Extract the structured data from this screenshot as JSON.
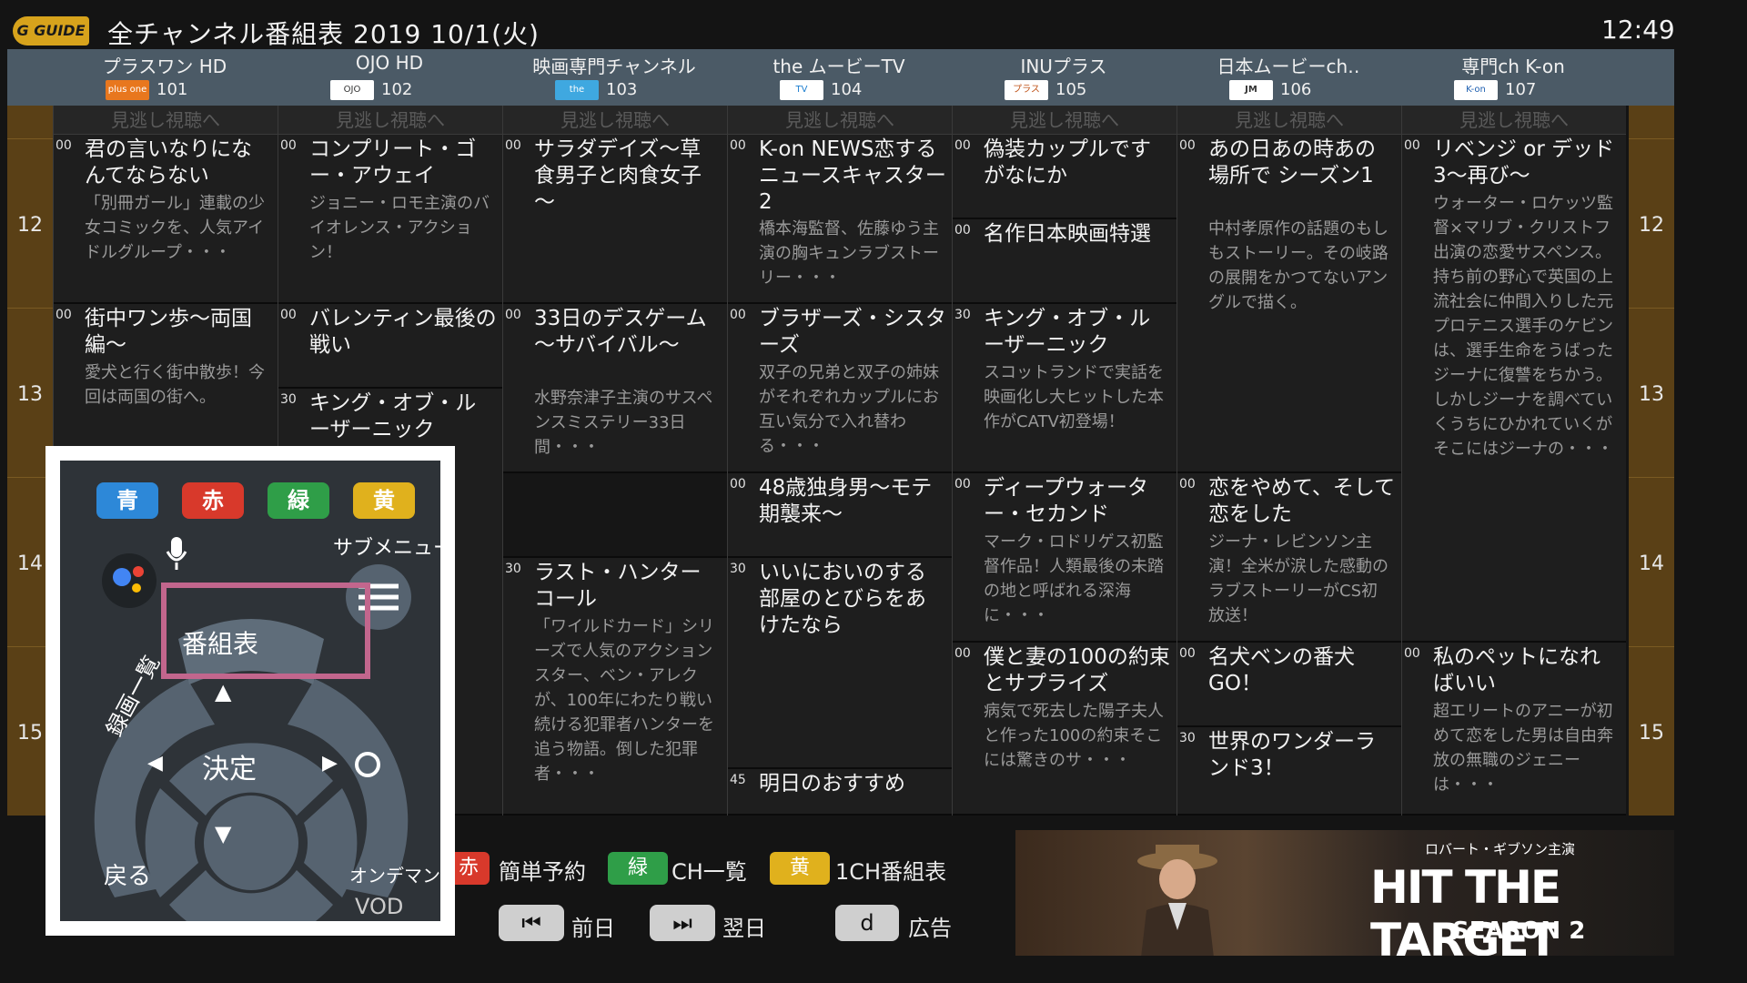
{
  "header": {
    "logo_text": "G GUIDE",
    "title": "全チャンネル番組表 2019 10/1(火)",
    "clock": "12:49"
  },
  "channels": [
    {
      "name": "プラスワン HD",
      "logo": "plus one",
      "number": "101"
    },
    {
      "name": "OJO HD",
      "logo": "OJO",
      "number": "102"
    },
    {
      "name": "映画専門チャンネル",
      "logo": "the MOVIE",
      "number": "103"
    },
    {
      "name": "the ムービーTV",
      "logo": "TV",
      "number": "104"
    },
    {
      "name": "INUプラス",
      "logo": "プラス",
      "number": "105"
    },
    {
      "name": "日本ムービーch‥",
      "logo": "JM",
      "number": "106"
    },
    {
      "name": "専門ch K-on",
      "logo": "K-on",
      "number": "107"
    }
  ],
  "hours": [
    "12",
    "13",
    "14",
    "15"
  ],
  "missed_label": "見逃し視聴へ",
  "programs": [
    [
      {
        "min": "00",
        "title": "君の言いなりになんてならない",
        "desc": "「別冊ガール」連載の少女コミックを、人気アイドルグループ・・・"
      },
      {
        "min": "00",
        "title": "街中ワン歩～両国編～",
        "desc": "愛犬と行く街中散歩！今回は両国の街へ。"
      }
    ],
    [
      {
        "min": "00",
        "title": "コンプリート・ゴー・アウェイ",
        "desc": "ジョニー・ロモ主演のバイオレンス・アクション！"
      },
      {
        "min": "00",
        "title": "バレンティン最後の戦い",
        "desc": ""
      },
      {
        "min": "30",
        "title": "キング・オブ・ルーザーニック",
        "desc": ""
      }
    ],
    [
      {
        "min": "00",
        "title": "サラダデイズ～草食男子と肉食女子～",
        "desc": ""
      },
      {
        "min": "00",
        "title": "33日のデスゲーム～サバイバル～",
        "desc": "水野奈津子主演のサスペンスミステリー33日間・・・"
      },
      {
        "min": "30",
        "title": "ラスト・ハンターコール",
        "desc": "「ワイルドカード」シリーズで人気のアクションスター、ベン・アレクが、100年にわたり戦い続ける犯罪者ハンターを追う物語。倒した犯罪者・・・"
      }
    ],
    [
      {
        "min": "00",
        "title": "K-on NEWS恋するニュースキャスター2",
        "desc": "橋本海監督、佐藤ゆう主演の胸キュンラブストーリー・・・"
      },
      {
        "min": "00",
        "title": "ブラザーズ・シスターズ",
        "desc": "双子の兄弟と双子の姉妹がそれぞれカップルにお互い気分で入れ替わる・・・"
      },
      {
        "min": "00",
        "title": "48歳独身男～モテ期襲来～",
        "desc": ""
      },
      {
        "min": "30",
        "title": "いいにおいのする部屋のとびらをあけたなら",
        "desc": ""
      },
      {
        "min": "45",
        "title": "明日のおすすめ",
        "desc": ""
      }
    ],
    [
      {
        "min": "00",
        "title": "偽装カップルですがなにか",
        "desc": ""
      },
      {
        "min": "00",
        "title": "名作日本映画特選",
        "desc": ""
      },
      {
        "min": "30",
        "title": "キング・オブ・ルーザーニック",
        "desc": "スコットランドで実話を映画化し大ヒットした本作がCATV初登場！"
      },
      {
        "min": "00",
        "title": "ディープウォーター・セカンド",
        "desc": "マーク・ロドリゲス初監督作品！人類最後の未踏の地と呼ばれる深海に・・・"
      },
      {
        "min": "00",
        "title": "僕と妻の100の約束とサプライズ",
        "desc": "病気で死去した陽子夫人と作った100の約束そこには驚きのサ・・・"
      }
    ],
    [
      {
        "min": "00",
        "title": "あの日あの時あの場所で シーズン1",
        "desc": "中村孝原作の話題のもしもストーリー。その岐路の展開をかつてないアングルで描く。"
      },
      {
        "min": "00",
        "title": "恋をやめて、そして恋をした",
        "desc": "ジーナ・レビンソン主演！全米が涙した感動のラブストーリーがCS初放送！"
      },
      {
        "min": "00",
        "title": "名犬ベンの番犬GO！",
        "desc": ""
      },
      {
        "min": "30",
        "title": "世界のワンダーランド3！",
        "desc": ""
      }
    ],
    [
      {
        "min": "00",
        "title": "リベンジ or デッド3～再び～",
        "desc": "ウォーター・ロケッツ監督×マリブ・クリストフ出演の恋愛サスペンス。持ち前の野心で英国の上流社会に仲間入りした元プロテニス選手のケビンは、選手生命をうばったジーナに復讐をちかう。しかしジーナを調べていくうちにひかれていくがそこにはジーナの・・・"
      },
      {
        "min": "00",
        "title": "私のペットになればいい",
        "desc": "超エリートのアニーが初めて恋をした男は自由奔放の無職のジェニーは・・・"
      }
    ]
  ],
  "bottom": {
    "red": "赤",
    "red_label": "簡単予約",
    "green": "緑",
    "green_label": "CH一覧",
    "yellow": "黄",
    "yellow_label": "1CH番組表",
    "prev_icon": "⏮",
    "prev_label": "前日",
    "next_icon": "⏭",
    "next_label": "翌日",
    "d_key": "d",
    "d_label": "広告"
  },
  "ad": {
    "subtitle": "ロバート・ギブソン主演",
    "title": "HIT THE TARGET",
    "season": "SEASON 2"
  },
  "remote": {
    "blue": "青",
    "red": "赤",
    "green": "緑",
    "yellow": "黄",
    "submenu": "サブメニュー",
    "guide": "番組表",
    "recorded": "録画一覧",
    "ok": "決定",
    "back": "戻る",
    "ondemand": "オンデマンド",
    "vod": "VOD",
    "up": "▲",
    "down": "▼",
    "left": "◀",
    "right": "▶"
  },
  "colors": {
    "red": "#d8392b",
    "green": "#2f9e48",
    "yellow": "#e0b11d",
    "blue": "#2d88d8",
    "highlight": "#c2668d"
  }
}
